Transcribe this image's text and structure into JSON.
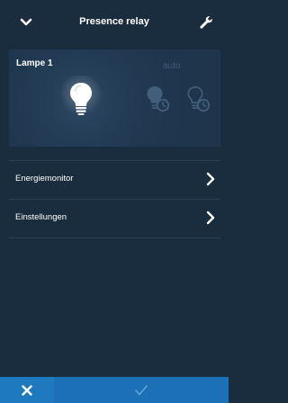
{
  "header": {
    "title": "Presence relay",
    "back_icon": "chevron-down-icon",
    "settings_icon": "wrench-icon"
  },
  "device": {
    "name": "Lampe 1",
    "mode_label": "auto",
    "state": "on"
  },
  "menu": {
    "items": [
      {
        "label": "Energiemonitor"
      },
      {
        "label": "Einstellungen"
      }
    ]
  },
  "footer": {
    "cancel_icon": "close-icon",
    "confirm_icon": "checkmark-icon"
  },
  "colors": {
    "background": "#1a2d3f",
    "accent": "#1c71b6",
    "inactive": "#3f5b76"
  }
}
